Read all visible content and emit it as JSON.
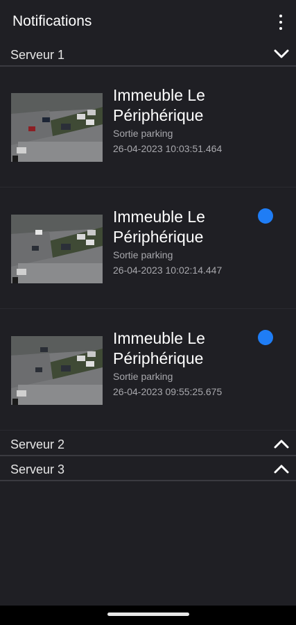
{
  "app": {
    "title": "Notifications"
  },
  "servers": [
    {
      "label": "Serveur 1",
      "expanded": true,
      "notifications": [
        {
          "title": "Immeuble Le Périphérique",
          "subtitle": "Sortie parking",
          "timestamp": "26-04-2023 10:03:51.464",
          "unread": false
        },
        {
          "title": "Immeuble Le Périphérique",
          "subtitle": "Sortie parking",
          "timestamp": "26-04-2023 10:02:14.447",
          "unread": true
        },
        {
          "title": "Immeuble Le Périphérique",
          "subtitle": "Sortie parking",
          "timestamp": "26-04-2023 09:55:25.675",
          "unread": true
        }
      ]
    },
    {
      "label": "Serveur 2",
      "expanded": false
    },
    {
      "label": "Serveur 3",
      "expanded": false
    }
  ],
  "colors": {
    "background": "#1f1f24",
    "unread_dot": "#1f7df5",
    "secondary_text": "#a8a8ad"
  },
  "icons": {
    "menu": "more-vert-icon",
    "collapse": "chevron-down-icon",
    "expand": "chevron-up-icon"
  }
}
